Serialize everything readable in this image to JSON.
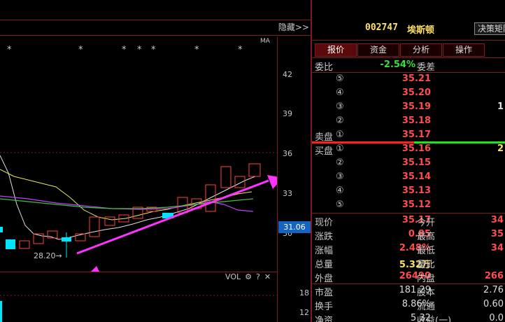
{
  "chart": {
    "hide_label": "隐藏>>",
    "ma_label": "MA",
    "star_glyph": "*",
    "price_ticks": [
      "42",
      "39",
      "36",
      "33",
      "30"
    ],
    "current_price_tag": "31.06",
    "low_label": "28.20→",
    "vol_label": "VOL",
    "vol_icons": [
      "gear-icon",
      "help-icon",
      "close-icon"
    ],
    "vol_ticks": [
      "18",
      "12"
    ]
  },
  "stock": {
    "code": "002747",
    "name": "埃斯顿",
    "decision_button": "决策矩阵"
  },
  "tabs": [
    "报价",
    "资金",
    "分析",
    "操作"
  ],
  "order_book": {
    "weibi_label": "委比",
    "weibi_value": "-2.54%",
    "weicha_label": "委差",
    "sell": [
      {
        "level": "⑤",
        "price": "35.21",
        "vol": ""
      },
      {
        "level": "④",
        "price": "35.20",
        "vol": ""
      },
      {
        "level": "③",
        "price": "35.19",
        "vol": "1"
      },
      {
        "level": "②",
        "price": "35.18",
        "vol": ""
      },
      {
        "level": "①",
        "price": "35.17",
        "vol": ""
      }
    ],
    "sell_label": "卖盘",
    "buy_label": "买盘",
    "buy": [
      {
        "level": "①",
        "price": "35.16",
        "vol": "2"
      },
      {
        "level": "②",
        "price": "35.15",
        "vol": ""
      },
      {
        "level": "③",
        "price": "35.14",
        "vol": ""
      },
      {
        "level": "④",
        "price": "35.13",
        "vol": ""
      },
      {
        "level": "⑤",
        "price": "35.12",
        "vol": ""
      }
    ]
  },
  "stats": [
    {
      "l1": "现价",
      "v1": "35.17",
      "c1": "r",
      "l2": "今开",
      "v2": "34"
    },
    {
      "l1": "涨跌",
      "v1": "0.85",
      "c1": "r",
      "l2": "最高",
      "v2": "35"
    },
    {
      "l1": "涨幅",
      "v1": "2.48%",
      "c1": "r",
      "l2": "最低",
      "v2": "34",
      "c2": "g"
    },
    {
      "l1": "总量",
      "v1": "5.32万",
      "c1": "y",
      "l2": "量比",
      "v2": "",
      "c2": "w"
    },
    {
      "l1": "外盘",
      "v1": "26490",
      "c1": "r",
      "l2": "内盘",
      "v2": "266",
      "c2": "g"
    },
    {
      "l1": "市盈",
      "v1": "181.29",
      "c1": "w",
      "l2": "股本",
      "v2": "2.76",
      "c2": "w"
    },
    {
      "l1": "换手",
      "v1": "8.86%",
      "c1": "w",
      "l2": "流通",
      "v2": "0.60",
      "c2": "w"
    },
    {
      "l1": "净资",
      "v1": "5.32",
      "c1": "w",
      "l2": "收益(一)",
      "v2": "0.0",
      "c2": "w"
    }
  ]
}
